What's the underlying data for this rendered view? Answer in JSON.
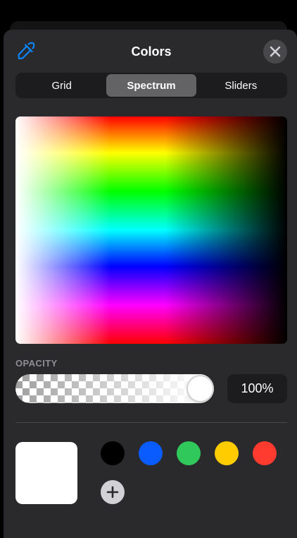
{
  "header": {
    "title": "Colors",
    "eyedropper_icon": "eyedropper-icon",
    "close_icon": "close-icon"
  },
  "tabs": [
    {
      "label": "Grid",
      "active": false
    },
    {
      "label": "Spectrum",
      "active": true
    },
    {
      "label": "Sliders",
      "active": false
    }
  ],
  "spectrum": {
    "hues": [
      "#ff0000",
      "#ffff00",
      "#00ff00",
      "#00ffff",
      "#0000ff",
      "#ff00ff",
      "#ff0000"
    ]
  },
  "opacity": {
    "label": "OPACITY",
    "value_text": "100%",
    "level": 1.0
  },
  "current_color": "#ffffff",
  "swatches": [
    {
      "name": "black",
      "color": "#000000"
    },
    {
      "name": "blue",
      "color": "#0a5cff"
    },
    {
      "name": "green",
      "color": "#30c85a"
    },
    {
      "name": "yellow",
      "color": "#ffcc00"
    },
    {
      "name": "red",
      "color": "#ff3b30"
    }
  ],
  "add_icon": "plus-icon",
  "colors": {
    "accent": "#0a84ff",
    "sheet_bg": "#2a2a2c"
  }
}
